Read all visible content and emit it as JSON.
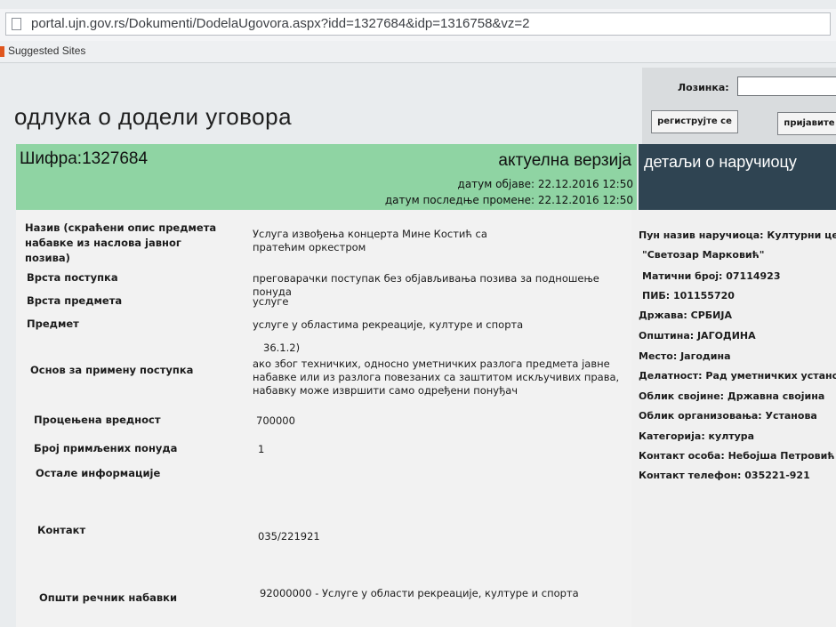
{
  "browser": {
    "url": "portal.ujn.gov.rs/Dokumenti/DodelaUgovora.aspx?idd=1327684&idp=1316758&vz=2",
    "bookmark": "Suggested Sites"
  },
  "login": {
    "password_label": "Лозинка:",
    "register_button": "региструјте се",
    "login_button": "пријавите"
  },
  "page": {
    "title": "одлука о додели уговора"
  },
  "status_bar": {
    "code": "Шифра:1327684",
    "version": "актуелна верзија",
    "published": "датум објаве: 22.12.2016 12:50",
    "modified": "датум последње промене: 22.12.2016 12:50"
  },
  "client_header": "детаљи о наручиоцу",
  "fields": [
    {
      "label": "Назив (скраћени опис предмета набавке из наслова јавног позива)",
      "value": "Услуга извођења концерта Мине Костић са пратећим оркестром"
    },
    {
      "label": "Врста поступка",
      "value": "преговарачки поступак без објављивања позива за подношење понуда"
    },
    {
      "label": "Врста предмета",
      "value": "услуге"
    },
    {
      "label": "Предмет",
      "value": "услуге у областима рекреације, културе и спорта"
    },
    {
      "label": "Основ за примену поступка",
      "value_code": "36.1.2)",
      "value": "ако због техничких, односно уметничких разлога предмета јавне набавке или из разлога повезаних са заштитом искључивих права, набавку може извршити само одређени понуђач"
    },
    {
      "label": "Процењена вредност",
      "value": "700000"
    },
    {
      "label": "Број примљених понуда",
      "value": "1"
    },
    {
      "label": "Остале информације",
      "value": ""
    },
    {
      "label": "Контакт",
      "value": "035/221921"
    },
    {
      "label": "Општи речник набавки",
      "value": "92000000 - Услуге у области рекреације, културе и спорта"
    }
  ],
  "client": {
    "full_name": "Пун назив наручиоца: Културни центар",
    "full_name_2": "\"Светозар Марковић\"",
    "id_number": "Матични број: 07114923",
    "pib": "ПИБ: 101155720",
    "country": "Држава: СРБИЈА",
    "municipality": "Општина: ЈАГОДИНА",
    "place": "Место: Јагодина",
    "activity": "Делатност: Рад уметничких установа",
    "ownership": "Облик својине: Државна својина",
    "org_form": "Облик организовања: Установа",
    "category": "Категорија: култура",
    "contact_person": "Контакт особа: Небојша Петровић",
    "contact_phone": "Контакт телефон: 035221-921"
  }
}
